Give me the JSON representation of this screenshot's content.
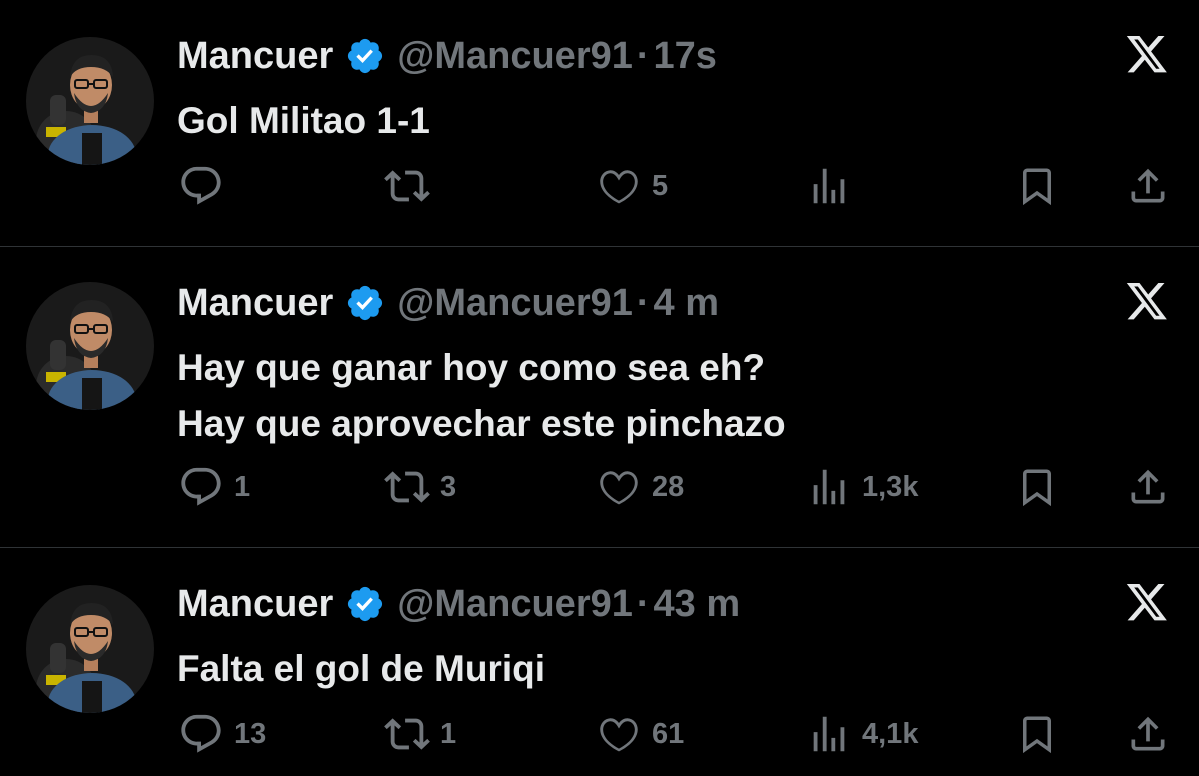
{
  "colors": {
    "background": "#000000",
    "text": "#e7e9ea",
    "muted": "#71767b",
    "verified": "#1d9bf0",
    "divider": "#2f3336"
  },
  "tweets": [
    {
      "author_name": "Mancuer",
      "handle": "@Mancuer91",
      "separator": "·",
      "time": "17s",
      "text_lines": [
        "Gol Militao 1-1"
      ],
      "replies": "",
      "retweets": "",
      "likes": "5",
      "views": ""
    },
    {
      "author_name": "Mancuer",
      "handle": "@Mancuer91",
      "separator": "·",
      "time": "4 m",
      "text_lines": [
        "Hay que ganar hoy como sea eh?",
        "Hay que aprovechar este pinchazo"
      ],
      "replies": "1",
      "retweets": "3",
      "likes": "28",
      "views": "1,3k"
    },
    {
      "author_name": "Mancuer",
      "handle": "@Mancuer91",
      "separator": "·",
      "time": "43 m",
      "text_lines": [
        "Falta el gol de Muriqi"
      ],
      "replies": "13",
      "retweets": "1",
      "likes": "61",
      "views": "4,1k"
    }
  ],
  "icons": {
    "avatar": "profile-photo",
    "verified": "verified-badge-icon",
    "x_logo": "x-logo-icon",
    "reply": "reply-icon",
    "retweet": "retweet-icon",
    "like": "heart-icon",
    "views": "views-chart-icon",
    "bookmark": "bookmark-icon",
    "share": "share-icon"
  }
}
